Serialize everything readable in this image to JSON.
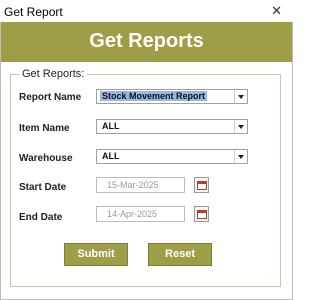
{
  "window": {
    "title": "Get Report"
  },
  "banner": {
    "heading": "Get Reports"
  },
  "group": {
    "legend": "Get Reports:"
  },
  "fields": {
    "report_name": {
      "label": "Report Name",
      "value": "Stock Movement Report"
    },
    "item_name": {
      "label": "Item Name",
      "value": "ALL"
    },
    "warehouse": {
      "label": "Warehouse",
      "value": "ALL"
    },
    "start_date": {
      "label": "Start Date",
      "value": "15-Mar-2025"
    },
    "end_date": {
      "label": "End Date",
      "value": "14-Apr-2025"
    }
  },
  "buttons": {
    "submit": "Submit",
    "reset": "Reset"
  },
  "colors": {
    "accent": "#9d9e47",
    "selection": "#98b7e2"
  },
  "icons": {
    "close": "close-icon",
    "dropdown": "chevron-down-icon",
    "calendar": "calendar-icon"
  }
}
